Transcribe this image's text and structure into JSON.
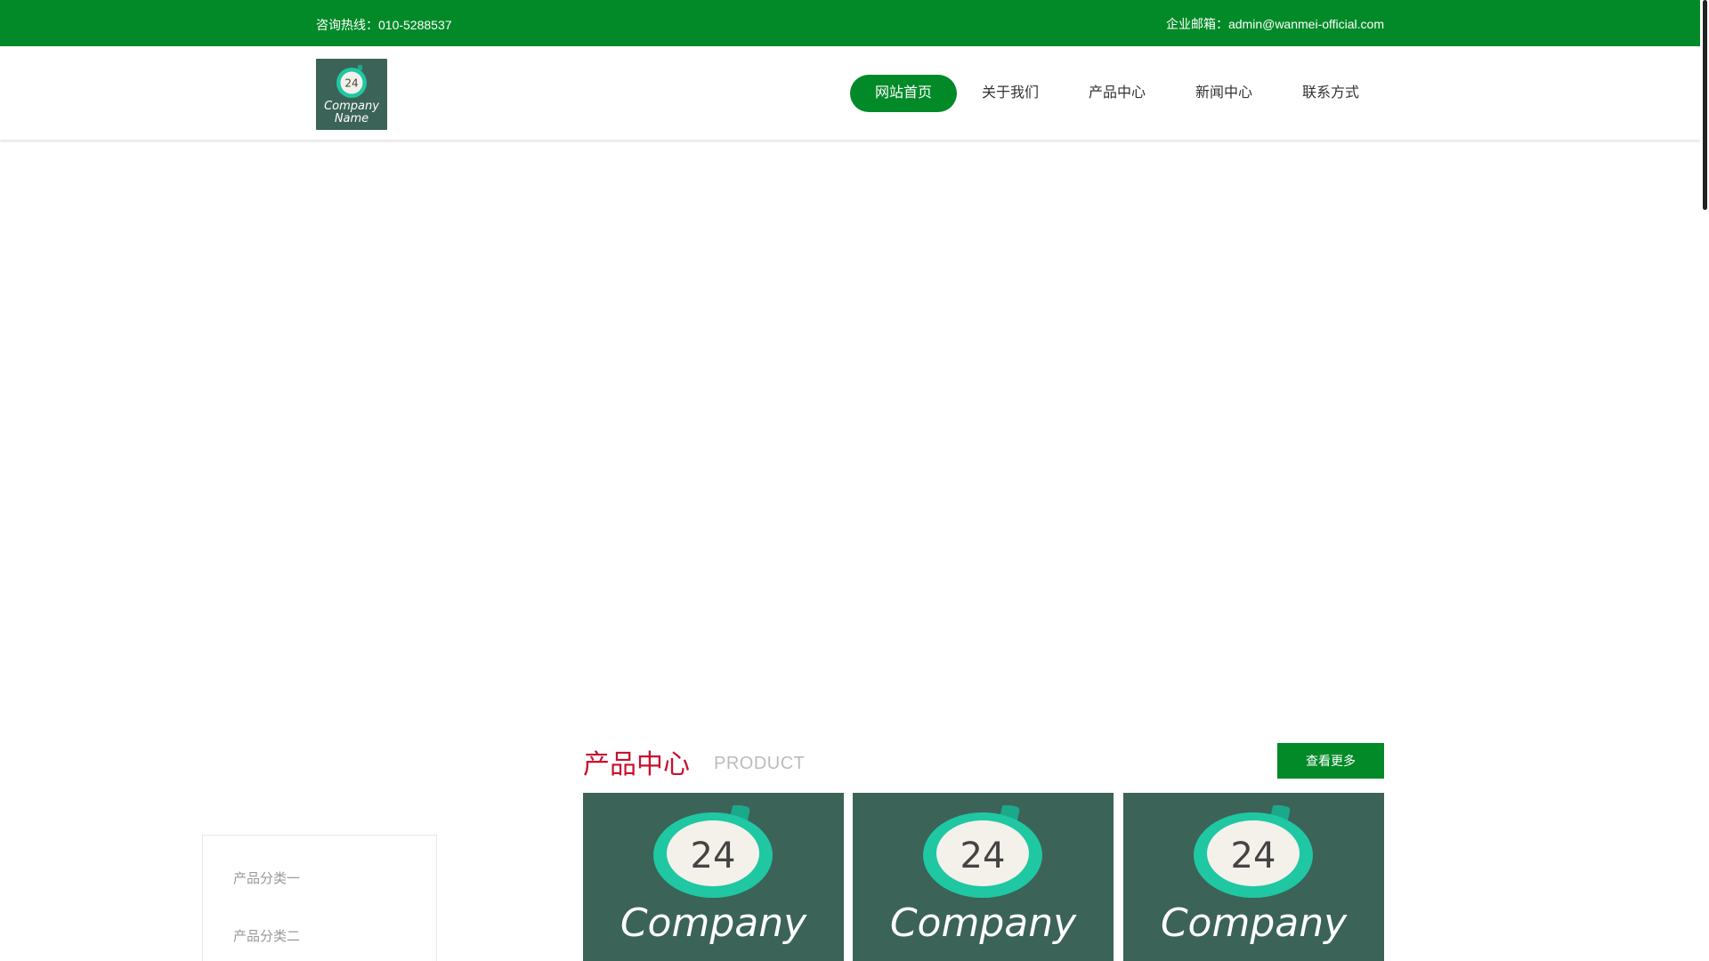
{
  "topbar": {
    "hotline_label": "咨询热线：010-5288537",
    "email_label": "企业邮箱：admin@wanmei-official.com"
  },
  "logo": {
    "clock_number": "24",
    "line1": "Company",
    "line2": "Name"
  },
  "nav": {
    "items": [
      {
        "label": "网站首页",
        "active": true
      },
      {
        "label": "关于我们",
        "active": false
      },
      {
        "label": "产品中心",
        "active": false
      },
      {
        "label": "新闻中心",
        "active": false
      },
      {
        "label": "联系方式",
        "active": false
      }
    ]
  },
  "products": {
    "title": "产品中心",
    "subtitle": "PRODUCT",
    "more_label": "查看更多",
    "categories": [
      "产品分类一",
      "产品分类二"
    ],
    "cards": [
      {
        "clock_number": "24",
        "name": "Company"
      },
      {
        "clock_number": "24",
        "name": "Company"
      },
      {
        "clock_number": "24",
        "name": "Company"
      }
    ]
  },
  "colors": {
    "brand_green": "#028a28",
    "title_red": "#c8102e",
    "logo_bg": "#3b6358",
    "clock_teal": "#1fc7a3"
  }
}
